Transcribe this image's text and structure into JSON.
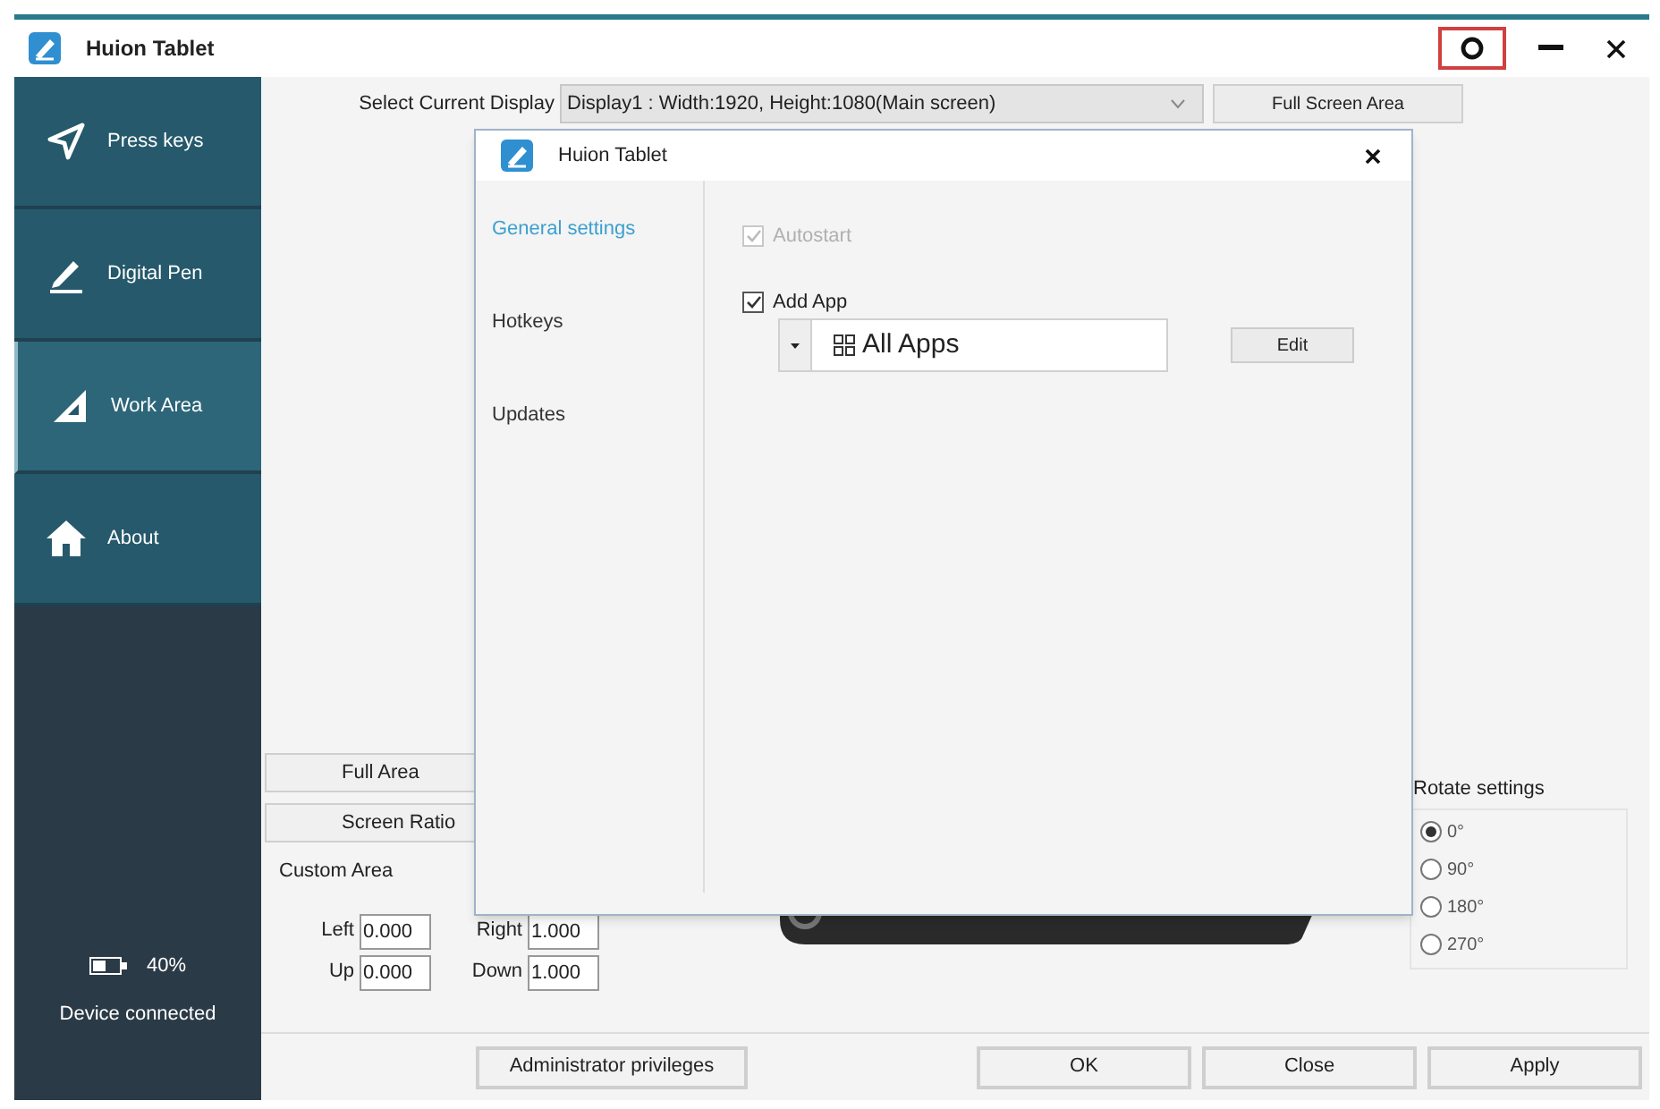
{
  "window": {
    "title": "Huion Tablet"
  },
  "sidebar": {
    "items": [
      {
        "label": "Press keys",
        "selected": false
      },
      {
        "label": "Digital Pen",
        "selected": false
      },
      {
        "label": "Work Area",
        "selected": true
      },
      {
        "label": "About",
        "selected": false
      }
    ],
    "battery_reading": "40%",
    "status": "Device connected"
  },
  "display": {
    "label": "Select Current Display",
    "value": "Display1 : Width:1920, Height:1080(Main screen)",
    "button": "Full Screen Area"
  },
  "area_buttons": [
    "Full Area",
    "Screen Ratio"
  ],
  "custom_area": {
    "title": "Custom Area",
    "fields": [
      {
        "label": "Left",
        "value": "0.000"
      },
      {
        "label": "Right",
        "value": "1.000"
      },
      {
        "label": "Up",
        "value": "0.000"
      },
      {
        "label": "Down",
        "value": "1.000"
      }
    ]
  },
  "rotate": {
    "title": "Rotate settings",
    "options": [
      {
        "label": "0°",
        "selected": true
      },
      {
        "label": "90°",
        "selected": false
      },
      {
        "label": "180°",
        "selected": false
      },
      {
        "label": "270°",
        "selected": false
      }
    ]
  },
  "footer_buttons": [
    "Administrator privileges",
    "OK",
    "Close",
    "Apply"
  ],
  "dialog": {
    "title": "Huion Tablet",
    "nav": [
      {
        "label": "General settings",
        "selected": true
      },
      {
        "label": "Hotkeys",
        "selected": false
      },
      {
        "label": "Updates",
        "selected": false
      }
    ],
    "options": [
      {
        "label": "Autostart",
        "checked": true,
        "disabled": true
      },
      {
        "label": "Add App",
        "checked": true,
        "disabled": false
      }
    ],
    "app_select": "All Apps",
    "edit_button": "Edit"
  }
}
